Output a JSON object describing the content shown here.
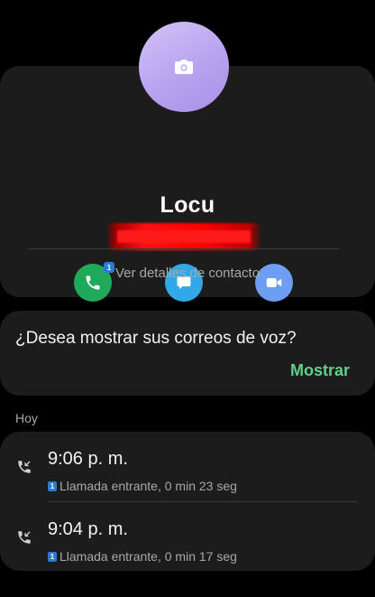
{
  "contact": {
    "name": "Locu",
    "details_link": "Ver detalles de contacto",
    "call_badge": "1"
  },
  "voicemail": {
    "question": "¿Desea mostrar sus correos de voz?",
    "show_label": "Mostrar"
  },
  "history": {
    "section_label": "Hoy",
    "calls": [
      {
        "time": "9:06 p. m.",
        "sim": "1",
        "description": "Llamada entrante, 0 min 23 seg"
      },
      {
        "time": "9:04 p. m.",
        "sim": "1",
        "description": "Llamada entrante, 0 min 17 seg"
      }
    ]
  },
  "colors": {
    "call_button": "#1faa5b",
    "message_button": "#32a8e6",
    "video_button": "#6d9ef1",
    "accent_green": "#5fcf8a",
    "card_background": "#1c1c1c"
  },
  "icons": {
    "avatar": "camera-icon",
    "call": "phone-icon",
    "message": "chat-bubble-icon",
    "video": "video-camera-icon",
    "incoming": "incoming-call-icon"
  }
}
